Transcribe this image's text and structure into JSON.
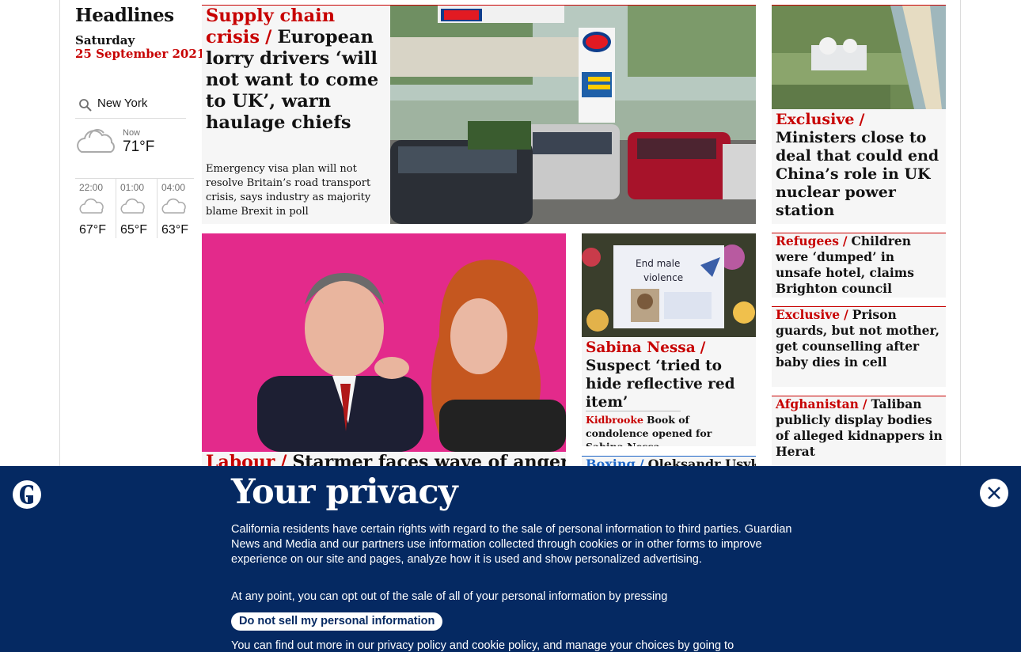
{
  "left": {
    "title": "Headlines",
    "day": "Saturday",
    "date": "25 September 2021",
    "location": "New York",
    "now_label": "Now",
    "now_temp": "71°F",
    "forecast": [
      {
        "time": "22:00",
        "temp": "67°F",
        "icon": "partly-cloudy-night-icon"
      },
      {
        "time": "01:00",
        "temp": "65°F",
        "icon": "partly-cloudy-night-icon"
      },
      {
        "time": "04:00",
        "temp": "63°F",
        "icon": "partly-cloudy-night-icon"
      }
    ]
  },
  "lead": {
    "kicker": "Supply chain crisis",
    "sep": "/",
    "headline": "European lorry drivers ‘will not want to come to UK’, warn haulage chiefs",
    "standfirst": "Emergency visa plan will not resolve Britain’s road transport crisis, says industry as majority blame Brexit in poll",
    "image_alt": "Queue of cars at an Esso petrol station"
  },
  "right_top": {
    "kicker": "Exclusive",
    "sep": "/",
    "headline": "Ministers close to deal that could end China’s role in UK nuclear power station"
  },
  "labour": {
    "kicker": "Labour",
    "sep": "/",
    "headline": "Starmer faces wave of anger"
  },
  "sabina": {
    "kicker": "Sabina Nessa",
    "sep": "/",
    "headline": "Suspect ‘tried to hide reflective red item’",
    "sub_kicker": "Kidbrooke",
    "sub_headline": "Book of condolence opened for Sabina Nessa"
  },
  "boxing": {
    "kicker": "Boxing",
    "sep": "/",
    "headline": "Oleksandr Usyk"
  },
  "side_items": [
    {
      "kicker": "Refugees",
      "sep": "/",
      "headline": "Children were ‘dumped’ in unsafe hotel, claims Brighton council"
    },
    {
      "kicker": "Exclusive",
      "sep": "/",
      "headline": "Prison guards, but not mother, get counselling after baby dies in cell"
    },
    {
      "kicker": "Afghanistan",
      "sep": "/",
      "headline": "Taliban publicly display bodies of alleged kidnappers in Herat"
    }
  ],
  "privacy": {
    "title": "Your privacy",
    "para1": "California residents have certain rights with regard to the sale of personal information to third parties. Guardian News and Media and our partners use information collected through cookies or in other forms to improve experience on our site and pages, analyze how it is used and show personalized advertising.",
    "para2": "At any point, you can opt out of the sale of all of your personal information by pressing",
    "button": "Do not sell my personal information",
    "para3": "You can find out more in our privacy policy and cookie policy, and manage your choices by going to"
  },
  "colors": {
    "accent": "#c70000",
    "brand": "#052962",
    "card": "#f6f6f6"
  }
}
